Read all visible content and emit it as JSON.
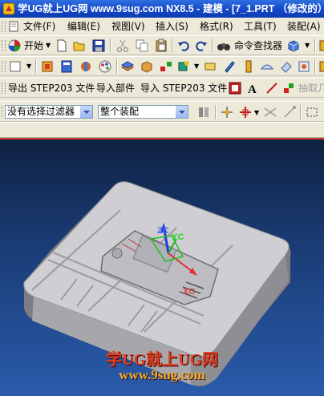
{
  "window": {
    "title": "学UG就上UG网 www.9sug.com NX8.5 - 建模 - [7_1.PRT （修改的）"
  },
  "menubar": {
    "items": [
      {
        "label": "文件(F)"
      },
      {
        "label": "编辑(E)"
      },
      {
        "label": "视图(V)"
      },
      {
        "label": "插入(S)"
      },
      {
        "label": "格式(R)"
      },
      {
        "label": "工具(T)"
      },
      {
        "label": "装配(A)"
      }
    ]
  },
  "toolbar1": {
    "start_label": "开始",
    "command_finder_label": "命令查找器"
  },
  "toolbar3": {
    "export_label": "导出 STEP203 文件",
    "import_part_label": "导入部件",
    "import_step_label": "导入 STEP203 文件",
    "extract_label": "抽取几"
  },
  "selection_bar": {
    "filter_value": "没有选择过滤器",
    "scope_value": "整个装配"
  },
  "viewport": {
    "axis_labels": {
      "zc": "ZC",
      "yc": "YC",
      "xc": "XC"
    },
    "watermark_line1": "学UG就上UG网",
    "watermark_line2": "www.9sug.com"
  },
  "colors": {
    "titlebar": "#1448c8",
    "viewport_top": "#0f2242",
    "viewport_bottom": "#2a5bab",
    "watermark_red": "#e04020",
    "watermark_gold": "#e8b020"
  }
}
